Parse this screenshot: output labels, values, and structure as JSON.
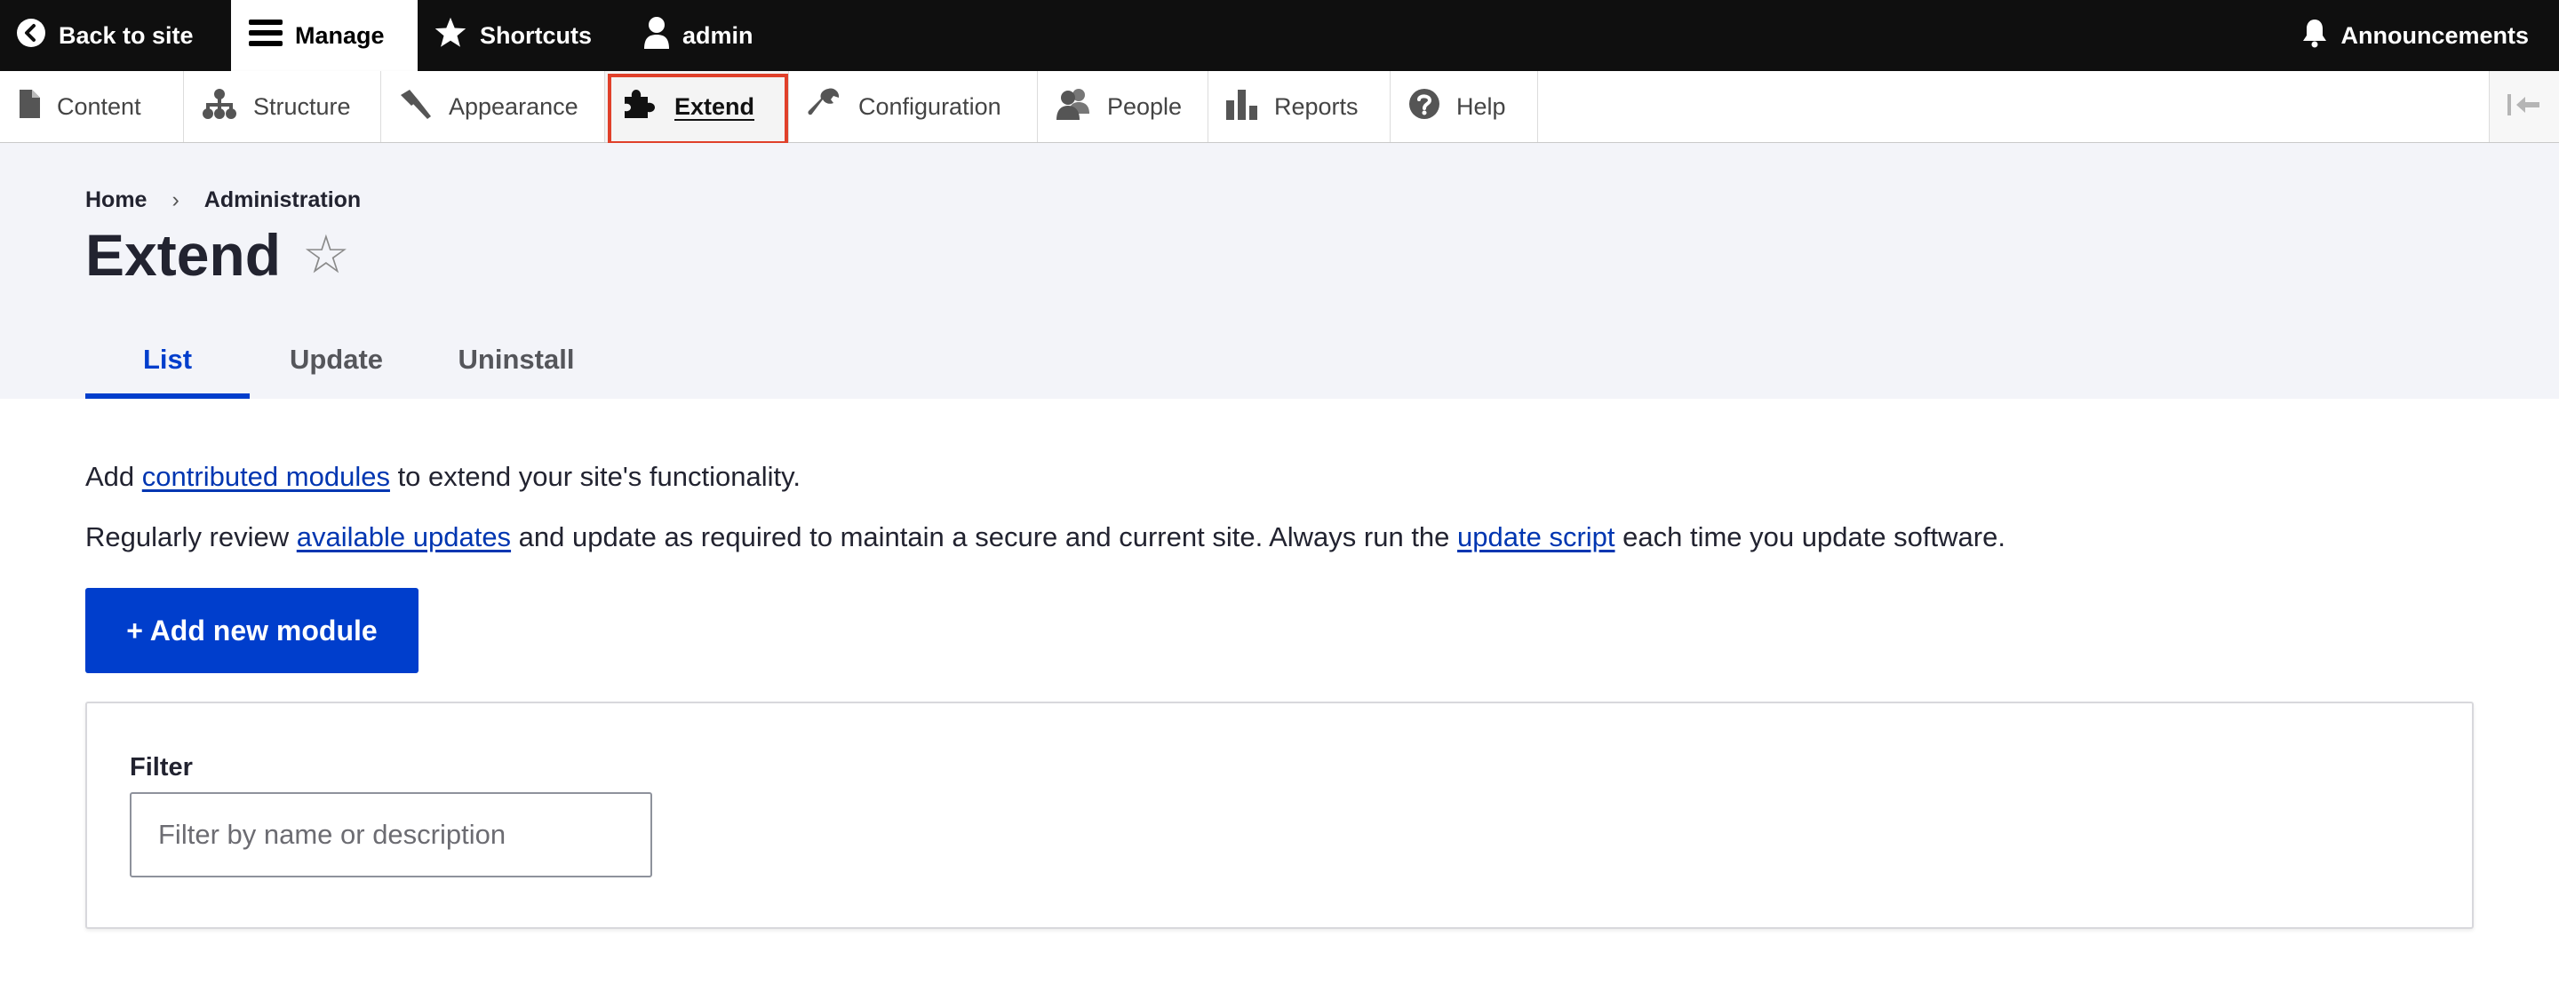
{
  "toolbar": {
    "back_label": "Back to site",
    "manage_label": "Manage",
    "shortcuts_label": "Shortcuts",
    "user_label": "admin",
    "announcements_label": "Announcements"
  },
  "tray": {
    "items": [
      {
        "label": "Content",
        "icon": "document-icon"
      },
      {
        "label": "Structure",
        "icon": "sitemap-icon"
      },
      {
        "label": "Appearance",
        "icon": "paintbrush-icon"
      },
      {
        "label": "Extend",
        "icon": "puzzle-icon",
        "active": true
      },
      {
        "label": "Configuration",
        "icon": "wrench-icon"
      },
      {
        "label": "People",
        "icon": "people-icon"
      },
      {
        "label": "Reports",
        "icon": "bar-chart-icon"
      },
      {
        "label": "Help",
        "icon": "help-icon"
      }
    ]
  },
  "breadcrumb": {
    "home": "Home",
    "separator": "›",
    "admin": "Administration"
  },
  "page": {
    "title": "Extend",
    "star": "☆"
  },
  "tabs": {
    "list": "List",
    "update": "Update",
    "uninstall": "Uninstall"
  },
  "content": {
    "p1_before": "Add ",
    "p1_link": "contributed modules",
    "p1_after": " to extend your site's functionality.",
    "p2_before": "Regularly review ",
    "p2_link1": "available updates",
    "p2_middle": " and update as required to maintain a secure and current site. Always run the ",
    "p2_link2": "update script",
    "p2_after": " each time you update software.",
    "add_button": "+ Add new module"
  },
  "filter": {
    "label": "Filter",
    "placeholder": "Filter by name or description",
    "value": ""
  },
  "colors": {
    "accent": "#003ecc",
    "toolbar_bg": "#0f0f0f",
    "header_bg": "#f3f4f9",
    "highlight_box": "#e0402a"
  }
}
